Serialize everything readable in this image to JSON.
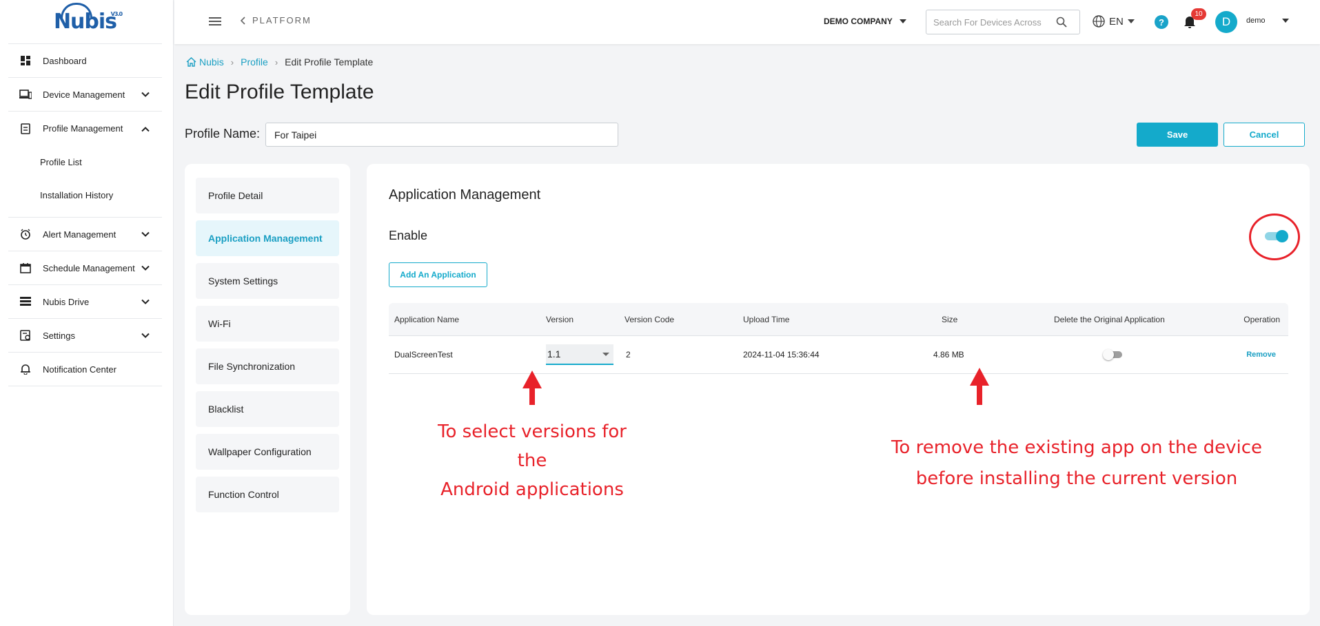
{
  "brand": {
    "name": "Nubis",
    "sup": "V3.0"
  },
  "sidebar": {
    "items": [
      {
        "label": "Dashboard",
        "icon": "dashboard-icon"
      },
      {
        "label": "Device Management",
        "icon": "devices-icon"
      },
      {
        "label": "Profile Management",
        "icon": "profile-icon"
      },
      {
        "label": "Alert Management",
        "icon": "alarm-icon"
      },
      {
        "label": "Schedule Management",
        "icon": "calendar-icon"
      },
      {
        "label": "Nubis Drive",
        "icon": "drive-icon"
      },
      {
        "label": "Settings",
        "icon": "settings-icon"
      },
      {
        "label": "Notification Center",
        "icon": "bell-icon"
      }
    ],
    "profile_sub": [
      "Profile List",
      "Installation History"
    ]
  },
  "topbar": {
    "platform": "PLATFORM",
    "company": "DEMO COMPANY",
    "search_placeholder": "Search For Devices Across",
    "lang": "EN",
    "help": "?",
    "notifications": "10",
    "avatar": "D",
    "user": "demo"
  },
  "breadcrumb": {
    "home": "Nubis",
    "profile": "Profile",
    "current": "Edit Profile Template"
  },
  "page_title": "Edit Profile Template",
  "profile_name": {
    "label": "Profile Name:",
    "value": "For Taipei"
  },
  "actions": {
    "save": "Save",
    "cancel": "Cancel"
  },
  "tabs": [
    "Profile Detail",
    "Application Management",
    "System Settings",
    "Wi-Fi",
    "File Synchronization",
    "Blacklist",
    "Wallpaper Configuration",
    "Function Control"
  ],
  "app_mgmt": {
    "title": "Application Management",
    "enable_label": "Enable",
    "enabled": true,
    "add_button": "Add An Application",
    "columns": [
      "Application Name",
      "Version",
      "Version Code",
      "Upload Time",
      "Size",
      "Delete the Original Application",
      "Operation"
    ],
    "rows": [
      {
        "name": "DualScreenTest",
        "version": "1.1",
        "version_code": "2",
        "upload_time": "2024-11-04 15:36:44",
        "size": "4.86 MB",
        "delete_original": false,
        "operation": "Remove"
      }
    ]
  },
  "annotations": {
    "version_note_line1": "To select versions for the",
    "version_note_line2": "Android applications",
    "delete_note_line1": "To remove the existing app on the device",
    "delete_note_line2": "before installing the current version"
  },
  "colors": {
    "accent": "#14aacb",
    "annotation": "#e8222a"
  }
}
